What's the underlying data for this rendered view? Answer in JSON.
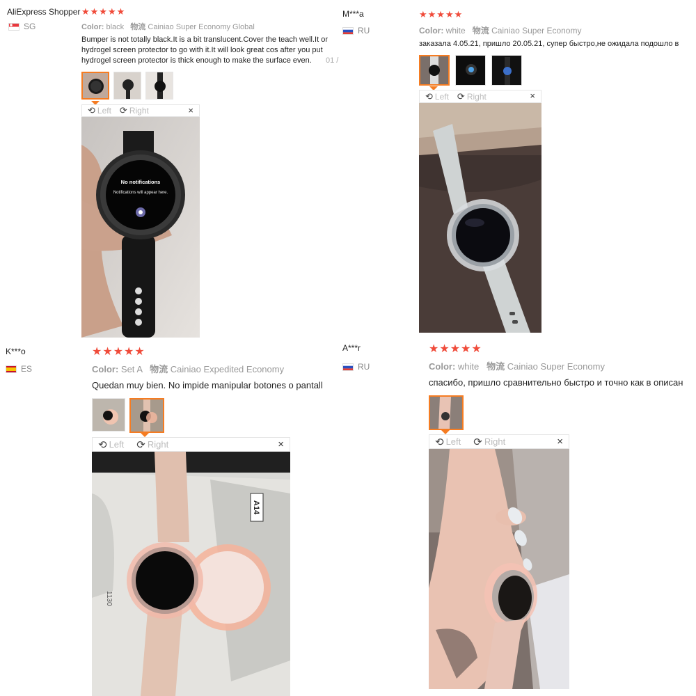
{
  "reviews": [
    {
      "user": "AliExpress Shopper",
      "country": "SG",
      "stars": "★★★★★",
      "color_label": "Color:",
      "color_value": "black",
      "shipping_label": "物流",
      "shipping_value": "Cainiao Super Economy Global",
      "text": "Bumper is not totally black.It is a bit translucent.Cover the teach well.It or hydrogel screen protector to go with it.It will look great cos after you put hydrogel screen protector is thick enough to make the surface even.",
      "date": "01 /",
      "viewer": {
        "left": "Left",
        "right": "Right",
        "close": "×"
      }
    },
    {
      "user": "M***a",
      "country": "RU",
      "stars": "★★★★★",
      "color_label": "Color:",
      "color_value": "white",
      "shipping_label": "物流",
      "shipping_value": "Cainiao Super Economy",
      "text": "заказала 4.05.21, пришло 20.05.21, супер быстро,не ожидала подошло в",
      "viewer": {
        "left": "Left",
        "right": "Right",
        "close": "×"
      }
    },
    {
      "user": "K***o",
      "country": "ES",
      "stars": "★★★★★",
      "color_label": "Color:",
      "color_value": "Set A",
      "shipping_label": "物流",
      "shipping_value": "Cainiao Expedited Economy",
      "text": "Quedan muy bien. No impide manipular botones o pantall",
      "viewer": {
        "left": "Left",
        "right": "Right",
        "close": "×"
      }
    },
    {
      "user": "A***r",
      "country": "RU",
      "stars": "★★★★★",
      "color_label": "Color:",
      "color_value": "white",
      "shipping_label": "物流",
      "shipping_value": "Cainiao Super Economy",
      "text": "спасибо, пришло сравнительно быстро и точно как в описан",
      "viewer": {
        "left": "Left",
        "right": "Right",
        "close": "×"
      }
    }
  ],
  "photo_text": {
    "watch_title": "No notifications",
    "watch_sub": "Notifications will appear here.",
    "package_code": "A14",
    "package_num": "1130"
  }
}
